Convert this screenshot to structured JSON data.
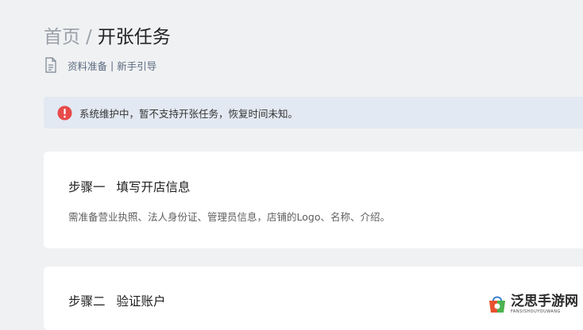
{
  "breadcrumb": {
    "home": "首页",
    "separator": "/",
    "current": "开张任务"
  },
  "doc_links": {
    "icon": "document-icon",
    "prepare": "资料准备",
    "divider": "|",
    "guide": "新手引导"
  },
  "alert": {
    "icon": "exclamation-circle-icon",
    "color": "#e84a4a",
    "text": "系统维护中，暂不支持开张任务，恢复时间未知。"
  },
  "steps": [
    {
      "number": "步骤一",
      "title": "填写开店信息",
      "description": "需准备营业执照、法人身份证、管理员信息，店铺的Logo、名称、介绍。"
    },
    {
      "number": "步骤二",
      "title": "验证账户"
    }
  ],
  "watermark": {
    "icon": "app-store-logo-icon",
    "text": "泛思手游网",
    "subtext": "FANSISHOUYOUWANG"
  }
}
